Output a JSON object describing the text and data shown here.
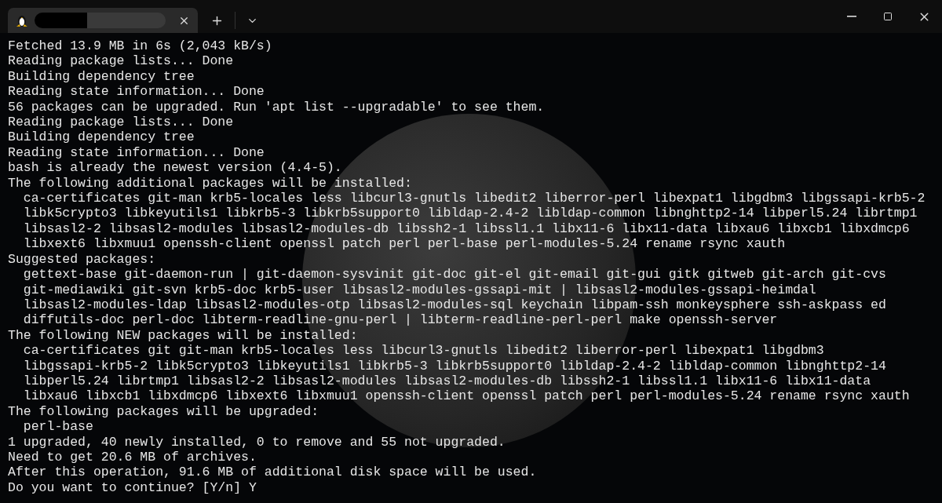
{
  "tab": {
    "title_redacted": true
  },
  "terminal": {
    "lines": [
      "Fetched 13.9 MB in 6s (2,043 kB/s)",
      "Reading package lists... Done",
      "Building dependency tree",
      "Reading state information... Done",
      "56 packages can be upgraded. Run 'apt list --upgradable' to see them.",
      "Reading package lists... Done",
      "Building dependency tree",
      "Reading state information... Done",
      "bash is already the newest version (4.4-5).",
      "The following additional packages will be installed:",
      "  ca-certificates git-man krb5-locales less libcurl3-gnutls libedit2 liberror-perl libexpat1 libgdbm3 libgssapi-krb5-2",
      "  libk5crypto3 libkeyutils1 libkrb5-3 libkrb5support0 libldap-2.4-2 libldap-common libnghttp2-14 libperl5.24 librtmp1",
      "  libsasl2-2 libsasl2-modules libsasl2-modules-db libssh2-1 libssl1.1 libx11-6 libx11-data libxau6 libxcb1 libxdmcp6",
      "  libxext6 libxmuu1 openssh-client openssl patch perl perl-base perl-modules-5.24 rename rsync xauth",
      "Suggested packages:",
      "  gettext-base git-daemon-run | git-daemon-sysvinit git-doc git-el git-email git-gui gitk gitweb git-arch git-cvs",
      "  git-mediawiki git-svn krb5-doc krb5-user libsasl2-modules-gssapi-mit | libsasl2-modules-gssapi-heimdal",
      "  libsasl2-modules-ldap libsasl2-modules-otp libsasl2-modules-sql keychain libpam-ssh monkeysphere ssh-askpass ed",
      "  diffutils-doc perl-doc libterm-readline-gnu-perl | libterm-readline-perl-perl make openssh-server",
      "The following NEW packages will be installed:",
      "  ca-certificates git git-man krb5-locales less libcurl3-gnutls libedit2 liberror-perl libexpat1 libgdbm3",
      "  libgssapi-krb5-2 libk5crypto3 libkeyutils1 libkrb5-3 libkrb5support0 libldap-2.4-2 libldap-common libnghttp2-14",
      "  libperl5.24 librtmp1 libsasl2-2 libsasl2-modules libsasl2-modules-db libssh2-1 libssl1.1 libx11-6 libx11-data",
      "  libxau6 libxcb1 libxdmcp6 libxext6 libxmuu1 openssh-client openssl patch perl perl-modules-5.24 rename rsync xauth",
      "The following packages will be upgraded:",
      "  perl-base",
      "1 upgraded, 40 newly installed, 0 to remove and 55 not upgraded.",
      "Need to get 20.6 MB of archives.",
      "After this operation, 91.6 MB of additional disk space will be used.",
      "Do you want to continue? [Y/n] Y"
    ]
  }
}
